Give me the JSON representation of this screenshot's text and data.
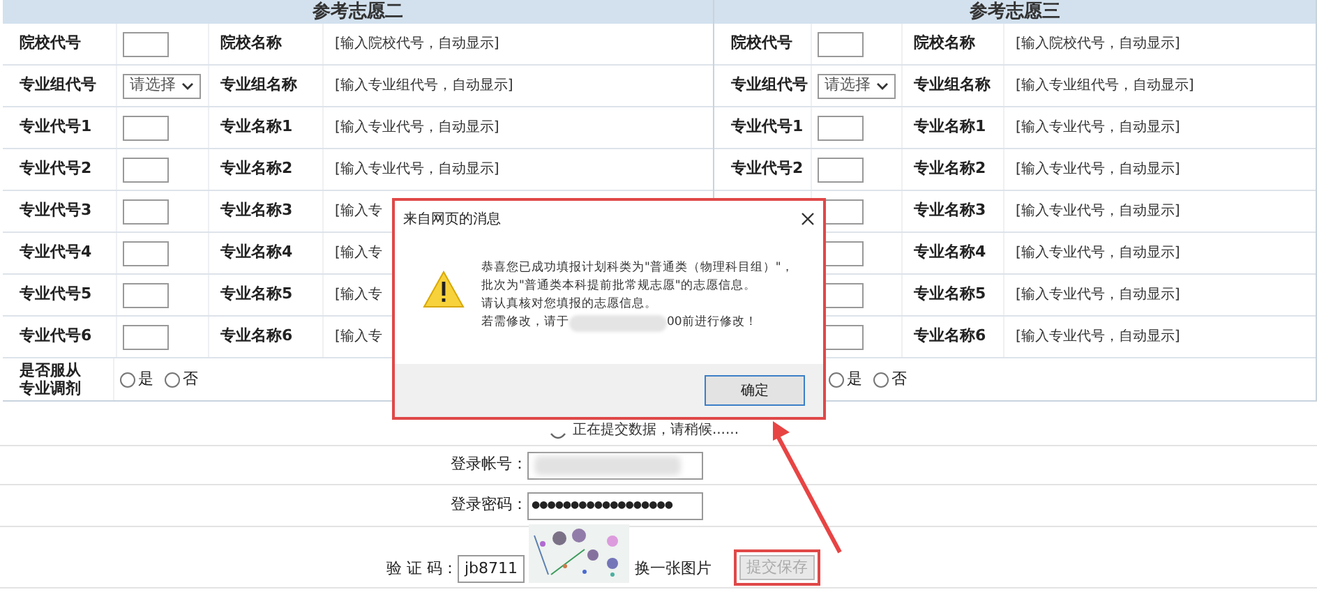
{
  "panels": [
    {
      "title": "参考志愿二",
      "rows": [
        {
          "label": "院校代号",
          "kind": "text",
          "name_label": "院校名称",
          "value": "[输入院校代号，自动显示]"
        },
        {
          "label": "专业组代号",
          "kind": "select",
          "select_value": "请选择",
          "name_label": "专业组名称",
          "value": "[输入专业组代号，自动显示]"
        },
        {
          "label": "专业代号1",
          "kind": "text",
          "name_label": "专业名称1",
          "value": "[输入专业代号，自动显示]"
        },
        {
          "label": "专业代号2",
          "kind": "text",
          "name_label": "专业名称2",
          "value": "[输入专业代号，自动显示]"
        },
        {
          "label": "专业代号3",
          "kind": "text",
          "name_label": "专业名称3",
          "value": "[输入专"
        },
        {
          "label": "专业代号4",
          "kind": "text",
          "name_label": "专业名称4",
          "value": "[输入专"
        },
        {
          "label": "专业代号5",
          "kind": "text",
          "name_label": "专业名称5",
          "value": "[输入专"
        },
        {
          "label": "专业代号6",
          "kind": "text",
          "name_label": "专业名称6",
          "value": "[输入专"
        }
      ],
      "adjust": {
        "label": "是否服从专业调剂",
        "options": [
          {
            "label": "是",
            "selected": false
          },
          {
            "label": "否",
            "selected": false
          }
        ]
      }
    },
    {
      "title": "参考志愿三",
      "rows": [
        {
          "label": "院校代号",
          "kind": "text",
          "name_label": "院校名称",
          "value": "[输入院校代号，自动显示]"
        },
        {
          "label": "专业组代号",
          "kind": "select",
          "select_value": "请选择",
          "name_label": "专业组名称",
          "value": "[输入专业组代号，自动显示]"
        },
        {
          "label": "专业代号1",
          "kind": "text",
          "name_label": "专业名称1",
          "value": "[输入专业代号，自动显示]"
        },
        {
          "label": "专业代号2",
          "kind": "text",
          "name_label": "专业名称2",
          "value": "[输入专业代号，自动显示]"
        },
        {
          "kind": "text",
          "name_label": "专业名称3",
          "value": "[输入专业代号，自动显示]"
        },
        {
          "kind": "text",
          "name_label": "专业名称4",
          "value": "[输入专业代号，自动显示]"
        },
        {
          "kind": "text",
          "name_label": "专业名称5",
          "value": "[输入专业代号，自动显示]"
        },
        {
          "kind": "text",
          "name_label": "专业名称6",
          "value": "[输入专业代号，自动显示]"
        }
      ],
      "adjust": {
        "options": [
          {
            "label": "是",
            "selected": false
          },
          {
            "label": "否",
            "selected": false
          }
        ]
      }
    }
  ],
  "loading_message": "正在提交数据，请稍候......",
  "login": {
    "account_label": "登录帐号：",
    "password_label": "登录密码：",
    "password_value": "●●●●●●●●●●●●●●●●●●",
    "captcha_label": "验 证 码：",
    "captcha_value": "jb8711",
    "refresh_link": "换一张图片",
    "submit_button": "提交保存"
  },
  "dialog": {
    "title": "来自网页的消息",
    "lines": [
      "恭喜您已成功填报计划科类为\"普通类（物理科目组）\"，",
      "批次为\"普通类本科提前批常规志愿\"的志愿信息。",
      "请认真核对您填报的志愿信息。"
    ],
    "last_line_start": "若需修改，请于",
    "last_line_end": "00前进行修改！",
    "ok_button": "确定"
  }
}
